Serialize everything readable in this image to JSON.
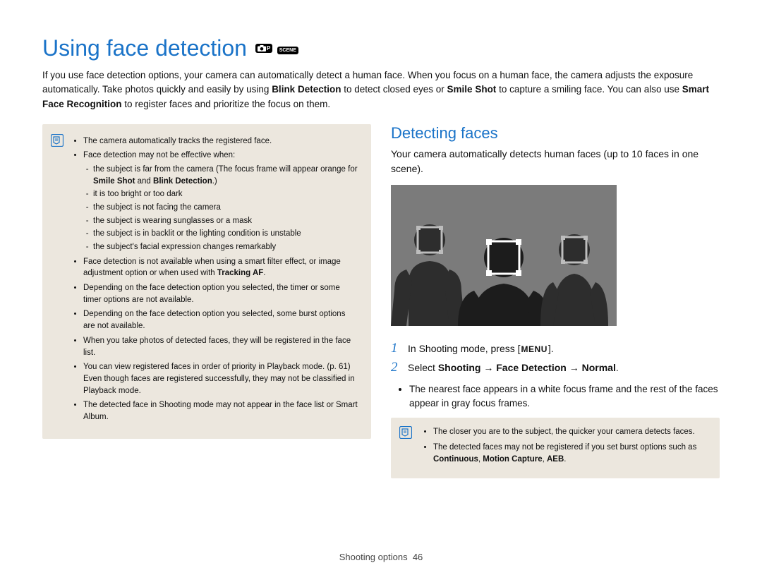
{
  "title": "Using face detection",
  "mode_icons": [
    "P",
    "SCENE"
  ],
  "intro_parts": [
    "If you use face detection options, your camera can automatically detect a human face. When you focus on a human face, the camera adjusts the exposure automatically. Take photos quickly and easily by using ",
    "Blink Detection",
    " to detect closed eyes or ",
    "Smile Shot",
    " to capture a smiling face. You can also use ",
    "Smart Face Recognition",
    " to register faces and prioritize the focus on them."
  ],
  "left_notes": {
    "items": [
      {
        "text": "The camera automatically tracks the registered face."
      },
      {
        "text": "Face detection may not be effective when:",
        "sub": [
          "the subject is far from the camera (The focus frame will appear orange for <b>Smile Shot</b> and <b>Blink Detection</b>.)",
          "it is too bright or too dark",
          "the subject is not facing the camera",
          "the subject is wearing sunglasses or a mask",
          "the subject is in backlit or the lighting condition is unstable",
          "the subject's facial expression changes remarkably"
        ]
      },
      {
        "text": "Face detection is not available when using a smart filter effect, or image adjustment option or when used with <b>Tracking AF</b>."
      },
      {
        "text": "Depending on the face detection option you selected, the timer or some timer options are not available."
      },
      {
        "text": "Depending on the face detection option you selected, some burst options are not available."
      },
      {
        "text": "When you take photos of detected faces, they will be registered in the face list."
      },
      {
        "text": "You can view registered faces in order of priority in Playback mode. (p. 61) Even though faces are registered successfully, they may not be classified in Playback mode."
      },
      {
        "text": "The detected face in Shooting mode may not appear in the face list or Smart Album."
      }
    ]
  },
  "right": {
    "heading": "Detecting faces",
    "intro": "Your camera automatically detects human faces (up to 10 faces in one scene).",
    "steps": [
      {
        "num": "1",
        "pre": "In Shooting mode, press [",
        "menu": "MENU",
        "post": "]. "
      },
      {
        "num": "2",
        "pre": "Select ",
        "bold": "Shooting → Face Detection → Normal",
        "post": "."
      }
    ],
    "frame_note": "The nearest face appears in a white focus frame and the rest of the faces appear in gray focus frames.",
    "tips": [
      "The closer you are to the subject, the quicker your camera detects faces.",
      "The detected faces may not be registered if you set burst options such as <b>Continuous</b>, <b>Motion Capture</b>, <b>AEB</b>."
    ]
  },
  "footer": {
    "section": "Shooting options",
    "page": "46"
  }
}
